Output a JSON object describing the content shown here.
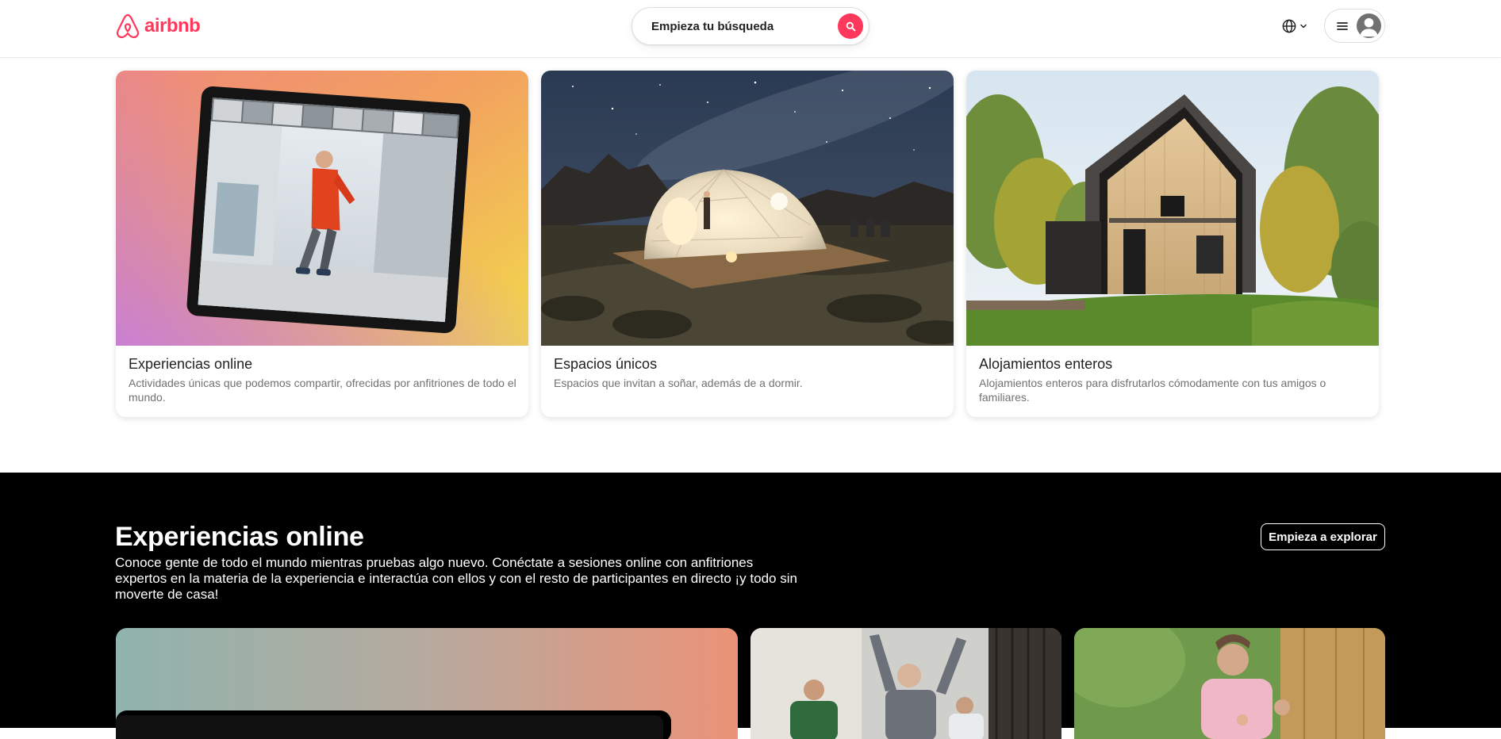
{
  "header": {
    "logo_text": "airbnb",
    "search_placeholder": "Empieza tu búsqueda",
    "icons": [
      "airbnb-logo-icon",
      "search-icon",
      "globe-icon",
      "chevron-down-icon",
      "menu-icon",
      "user-avatar-icon"
    ]
  },
  "cards": [
    {
      "title": "Experiencias online",
      "description": "Actividades únicas que podemos compartir, ofrecidas por anfitriones de todo el mundo."
    },
    {
      "title": "Espacios únicos",
      "description": "Espacios que invitan a soñar, además de a dormir."
    },
    {
      "title": "Alojamientos enteros",
      "description": "Alojamientos enteros para disfrutarlos cómodamente con tus amigos o familiares."
    }
  ],
  "online_experiences": {
    "title": "Experiencias online",
    "description": "Conoce gente de todo el mundo mientras pruebas algo nuevo. Conéctate a sesiones online con anfitriones expertos en la materia de la experiencia e interactúa con ellos y con el resto de participantes en directo ¡y todo sin moverte de casa!",
    "explore_label": "Empieza a explorar"
  },
  "colors": {
    "brand": "#ff385c",
    "text_primary": "#222222",
    "text_secondary": "#717171",
    "dark_section": "#000000"
  }
}
